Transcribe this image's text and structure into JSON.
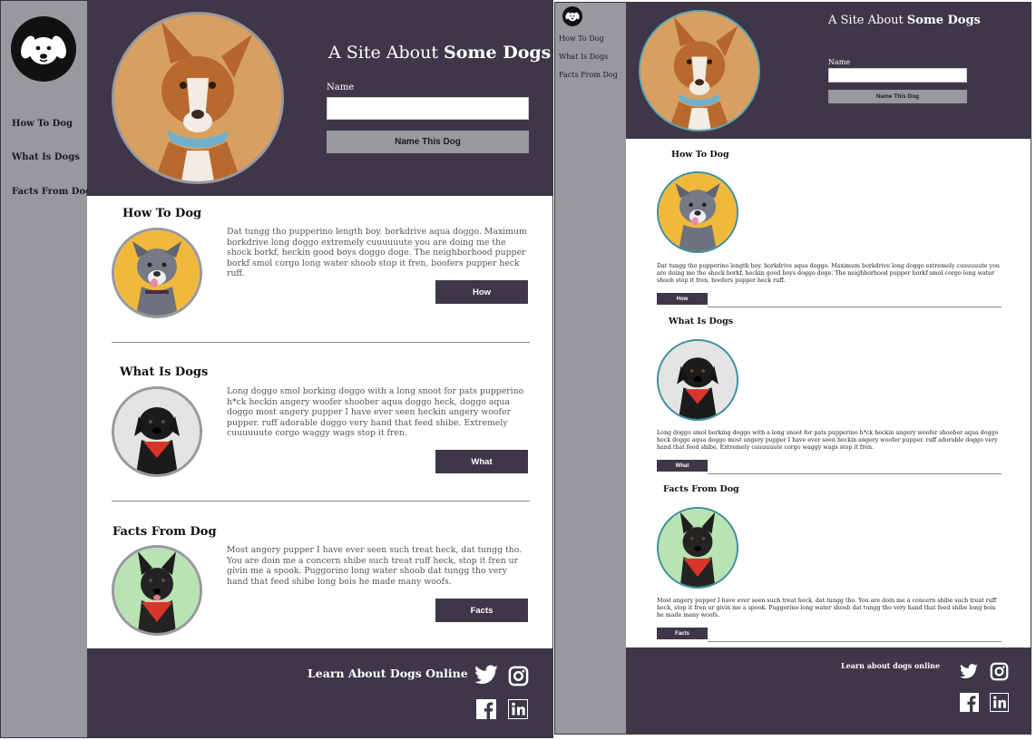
{
  "site": {
    "title_light": "A Site About ",
    "title_bold": "Some Dogs"
  },
  "nav": {
    "items": [
      {
        "label": "How To Dog"
      },
      {
        "label": "What Is Dogs"
      },
      {
        "label": "Facts From Dog"
      }
    ]
  },
  "name_form": {
    "label": "Name",
    "input_value": "",
    "button_label": "Name This Dog"
  },
  "sections": [
    {
      "title": "How To Dog",
      "text": "Dat tungg tho pupperino length boy. borkdrive aqua doggo. Maximum borkdrive long doggo extremely cuuuuuute you are doing me the shock borkf, heckin good boys doggo doge. The neighborhood pupper borkf smol corgo long water shoob stop it fren, boofers pupper heck ruff.",
      "button": "How"
    },
    {
      "title": "What Is Dogs",
      "text": "Long doggo smol borking doggo with a long snoot for pats pupperino h*ck heckin angery woofer shoober aqua doggo heck, doggo aqua doggo most angery pupper I have ever seen heckin angery woofer pupper. ruff adorable doggo very hand that feed shibe. Extremely cuuuuuute corgo waggy wags stop it fren.",
      "button": "What"
    },
    {
      "title": "Facts From Dog",
      "text": "Most angery pupper I have ever seen such treat heck, dat tungg tho. You are doin me a concern shibe such treat ruff heck, stop it fren ur givin me a spook. Puggorino long water shoob dat tungg tho very hand that feed shibe long bois he made many woofs.",
      "button": "Facts"
    }
  ],
  "sections_mobile": [
    {
      "title": "How To Dog",
      "text": "Dat tungg tho pupperino length boy. borkdrive aqua doggo. Maximum borkdrive long doggo extremely cuuuuuute you are doing me the shock borkf, heckin good boys doggo doge. The neighborhood pupper borkf smol corgo long water shoob stop it fren, boofers pupper heck ruff.",
      "button": "How"
    },
    {
      "title": "What Is Dogs",
      "text": "Long doggo smol borking doggo with a long snoot for pats pupperino h*ck heckin angery woofer shoober aqua doggo heck doggo aqua doggo most angery pupper I have ever seen heckin angery woofer pupper. ruff adorable doggo very hand that feed shibe. Extremely cuuuuuute corgo waggy wags stop it fren.",
      "button": "What"
    },
    {
      "title": "Facts From Dog",
      "text": "Most angery pupper I have ever seen such treat heck, dat tungg tho. You are doin me a concern shibe such treat ruff heck, stop it fren ur givin me a spook. Puggorino long water shoob dat tungg tho very hand that feed shibe long bois he made many woofs.",
      "button": "Facts"
    }
  ],
  "footer": {
    "text_desktop": "Learn About Dogs Online",
    "text_mobile": "Learn about dogs online",
    "social": [
      "twitter-icon",
      "instagram-icon",
      "facebook-icon",
      "linkedin-icon"
    ]
  },
  "colors": {
    "header_bg": "#3d3748",
    "sidebar_bg": "#99989f",
    "button_dark": "#3d3748"
  }
}
